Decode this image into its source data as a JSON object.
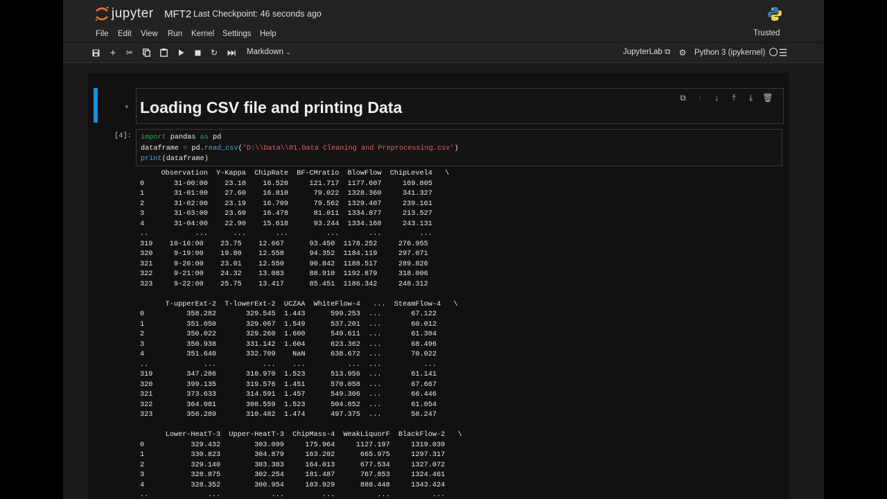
{
  "header": {
    "logo_text": "jupyter",
    "notebook_name": "MFT2",
    "checkpoint": "Last Checkpoint: 46 seconds ago",
    "kernel_icon": "python-logo"
  },
  "menu": {
    "items": [
      "File",
      "Edit",
      "View",
      "Run",
      "Kernel",
      "Settings",
      "Help"
    ],
    "trusted": "Trusted"
  },
  "toolbar": {
    "icons": [
      "save-icon",
      "add-cell-icon",
      "cut-icon",
      "copy-icon",
      "paste-icon",
      "run-icon",
      "stop-icon",
      "restart-icon",
      "fast-forward-icon"
    ],
    "cell_type": "Markdown",
    "jupyterlab": "JupyterLab",
    "kernel": "Python 3 (ipykernel)"
  },
  "cells": {
    "markdown_title": "Loading CSV file and printing Data",
    "prompt": "[4]:",
    "code_lines": [
      [
        [
          "kw",
          "import"
        ],
        [
          "plain",
          " pandas "
        ],
        [
          "kw",
          "as"
        ],
        [
          "plain",
          " pd"
        ]
      ],
      [
        [
          "plain",
          "dataframe "
        ],
        [
          "op",
          "="
        ],
        [
          "plain",
          " pd."
        ],
        [
          "fn",
          "read_csv"
        ],
        [
          "plain",
          "("
        ],
        [
          "str",
          "'D:\\\\Data\\\\01.Data Cleaning and Preprocessing.csv'"
        ],
        [
          "plain",
          ")"
        ]
      ],
      [
        [
          "fn",
          "print"
        ],
        [
          "plain",
          "(dataframe)"
        ]
      ]
    ]
  },
  "output": {
    "lines": [
      "     Observation  Y-Kappa  ChipRate  BF-CMratio  BlowFlow  ChipLevel4   \\",
      "0       31-00:00    23.10    16.520     121.717  1177.607     169.805",
      "1       31-01:00    27.60    16.810      79.022  1328.360     341.327",
      "2       31-02:00    23.19    16.709      79.562  1329.407     239.161",
      "3       31-03:00    23.60    16.478      81.011  1334.877     213.527",
      "4       31-04:00    22.90    15.618      93.244  1334.168     243.131",
      "..           ...      ...       ...         ...       ...         ...",
      "319    10-16:00    23.75    12.667      93.450  1178.252     276.955",
      "320     9-19:00    19.80    12.558      94.352  1184.119     297.071",
      "321     9-20:00    23.01    12.550      90.842  1188.517     289.826",
      "322     9-21:00    24.32    13.083      88.910  1192.879     318.006",
      "323     9-22:00    25.75    13.417      85.451  1186.342     248.312",
      "",
      "      T-upperExt-2  T-lowerExt-2  UCZAA  WhiteFlow-4   ...  SteamFlow-4   \\",
      "0          358.282       329.545  1.443      599.253  ...       67.122",
      "1          351.050       329.067  1.549      537.201  ...       60.012",
      "2          350.022       329.260  1.600      549.611  ...       61.304",
      "3          350.938       331.142  1.604      623.362  ...       68.496",
      "4          351.640       332.709    NaN      638.672  ...       70.022",
      "..             ...           ...    ...          ...  ...          ...",
      "319        347.286       310.970  1.523      513.956  ...       61.141",
      "320        399.135       319.576  1.451      570.058  ...       67.667",
      "321        373.633       314.591  1.457      549.306  ...       66.446",
      "322        364.081       308.559  1.523      504.852  ...       61.054",
      "323        356.289       310.482  1.474      497.375  ...       58.247",
      "",
      "      Lower-HeatT-3  Upper-HeatT-3  ChipMass-4  WeakLiquorF  BlackFlow-2   \\",
      "0           329.432        303.099     175.964     1127.197     1319.039",
      "1           330.823        304.879     163.202      665.975     1297.317",
      "2           329.140        303.383     164.013      677.534     1327.072",
      "3           328.875        302.254     181.487      767.853     1324.461",
      "4           328.352        300.954     183.929      888.448     1343.424",
      "..              ...            ...         ...          ...          ..."
    ]
  }
}
